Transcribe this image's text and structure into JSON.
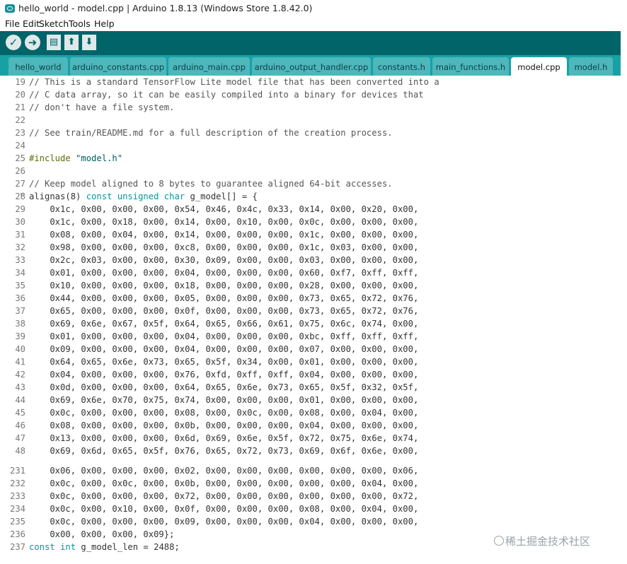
{
  "window": {
    "title": "hello_world - model.cpp | Arduino 1.8.13 (Windows Store 1.8.42.0)"
  },
  "menu": {
    "items": [
      "File",
      "Edit",
      "Sketch",
      "Tools",
      "Help"
    ]
  },
  "toolbar": {
    "buttons": [
      "verify-icon",
      "upload-icon",
      "new-icon",
      "open-icon",
      "save-icon"
    ]
  },
  "tabs": [
    {
      "label": "hello_world",
      "active": false
    },
    {
      "label": "arduino_constants.cpp",
      "active": false
    },
    {
      "label": "arduino_main.cpp",
      "active": false
    },
    {
      "label": "arduino_output_handler.cpp",
      "active": false
    },
    {
      "label": "constants.h",
      "active": false
    },
    {
      "label": "main_functions.h",
      "active": false
    },
    {
      "label": "model.cpp",
      "active": true
    },
    {
      "label": "model.h",
      "active": false
    }
  ],
  "editor": {
    "top_lines": [
      {
        "n": "19",
        "t": "// This is a standard TensorFlow Lite model file that has been converted into a"
      },
      {
        "n": "20",
        "t": "// C data array, so it can be easily compiled into a binary for devices that"
      },
      {
        "n": "21",
        "t": "// don't have a file system."
      },
      {
        "n": "22",
        "t": ""
      },
      {
        "n": "23",
        "t": "// See train/README.md for a full description of the creation process."
      },
      {
        "n": "24",
        "t": ""
      },
      {
        "n": "25",
        "t": "#include \"model.h\""
      },
      {
        "n": "26",
        "t": ""
      },
      {
        "n": "27",
        "t": "// Keep model aligned to 8 bytes to guarantee aligned 64-bit accesses."
      },
      {
        "n": "28",
        "t": "alignas(8) const unsigned char g_model[] = {"
      },
      {
        "n": "29",
        "t": "    0x1c, 0x00, 0x00, 0x00, 0x54, 0x46, 0x4c, 0x33, 0x14, 0x00, 0x20, 0x00,"
      },
      {
        "n": "30",
        "t": "    0x1c, 0x00, 0x18, 0x00, 0x14, 0x00, 0x10, 0x00, 0x0c, 0x00, 0x00, 0x00,"
      },
      {
        "n": "31",
        "t": "    0x08, 0x00, 0x04, 0x00, 0x14, 0x00, 0x00, 0x00, 0x1c, 0x00, 0x00, 0x00,"
      },
      {
        "n": "32",
        "t": "    0x98, 0x00, 0x00, 0x00, 0xc8, 0x00, 0x00, 0x00, 0x1c, 0x03, 0x00, 0x00,"
      },
      {
        "n": "33",
        "t": "    0x2c, 0x03, 0x00, 0x00, 0x30, 0x09, 0x00, 0x00, 0x03, 0x00, 0x00, 0x00,"
      },
      {
        "n": "34",
        "t": "    0x01, 0x00, 0x00, 0x00, 0x04, 0x00, 0x00, 0x00, 0x60, 0xf7, 0xff, 0xff,"
      },
      {
        "n": "35",
        "t": "    0x10, 0x00, 0x00, 0x00, 0x18, 0x00, 0x00, 0x00, 0x28, 0x00, 0x00, 0x00,"
      },
      {
        "n": "36",
        "t": "    0x44, 0x00, 0x00, 0x00, 0x05, 0x00, 0x00, 0x00, 0x73, 0x65, 0x72, 0x76,"
      },
      {
        "n": "37",
        "t": "    0x65, 0x00, 0x00, 0x00, 0x0f, 0x00, 0x00, 0x00, 0x73, 0x65, 0x72, 0x76,"
      },
      {
        "n": "38",
        "t": "    0x69, 0x6e, 0x67, 0x5f, 0x64, 0x65, 0x66, 0x61, 0x75, 0x6c, 0x74, 0x00,"
      },
      {
        "n": "39",
        "t": "    0x01, 0x00, 0x00, 0x00, 0x04, 0x00, 0x00, 0x00, 0xbc, 0xff, 0xff, 0xff,"
      },
      {
        "n": "40",
        "t": "    0x09, 0x00, 0x00, 0x00, 0x04, 0x00, 0x00, 0x00, 0x07, 0x00, 0x00, 0x00,"
      },
      {
        "n": "41",
        "t": "    0x64, 0x65, 0x6e, 0x73, 0x65, 0x5f, 0x34, 0x00, 0x01, 0x00, 0x00, 0x00,"
      },
      {
        "n": "42",
        "t": "    0x04, 0x00, 0x00, 0x00, 0x76, 0xfd, 0xff, 0xff, 0x04, 0x00, 0x00, 0x00,"
      },
      {
        "n": "43",
        "t": "    0x0d, 0x00, 0x00, 0x00, 0x64, 0x65, 0x6e, 0x73, 0x65, 0x5f, 0x32, 0x5f,"
      },
      {
        "n": "44",
        "t": "    0x69, 0x6e, 0x70, 0x75, 0x74, 0x00, 0x00, 0x00, 0x01, 0x00, 0x00, 0x00,"
      },
      {
        "n": "45",
        "t": "    0x0c, 0x00, 0x00, 0x00, 0x08, 0x00, 0x0c, 0x00, 0x08, 0x00, 0x04, 0x00,"
      },
      {
        "n": "46",
        "t": "    0x08, 0x00, 0x00, 0x00, 0x0b, 0x00, 0x00, 0x00, 0x04, 0x00, 0x00, 0x00,"
      },
      {
        "n": "47",
        "t": "    0x13, 0x00, 0x00, 0x00, 0x6d, 0x69, 0x6e, 0x5f, 0x72, 0x75, 0x6e, 0x74,"
      },
      {
        "n": "48",
        "t": "    0x69, 0x6d, 0x65, 0x5f, 0x76, 0x65, 0x72, 0x73, 0x69, 0x6f, 0x6e, 0x00,"
      }
    ],
    "bottom_lines": [
      {
        "n": "231",
        "t": "    0x06, 0x00, 0x00, 0x00, 0x02, 0x00, 0x00, 0x00, 0x00, 0x00, 0x00, 0x06,"
      },
      {
        "n": "232",
        "t": "    0x0c, 0x00, 0x0c, 0x00, 0x0b, 0x00, 0x00, 0x00, 0x00, 0x00, 0x04, 0x00,"
      },
      {
        "n": "233",
        "t": "    0x0c, 0x00, 0x00, 0x00, 0x72, 0x00, 0x00, 0x00, 0x00, 0x00, 0x00, 0x72,"
      },
      {
        "n": "234",
        "t": "    0x0c, 0x00, 0x10, 0x00, 0x0f, 0x00, 0x00, 0x00, 0x08, 0x00, 0x04, 0x00,"
      },
      {
        "n": "235",
        "t": "    0x0c, 0x00, 0x00, 0x00, 0x09, 0x00, 0x00, 0x00, 0x04, 0x00, 0x00, 0x00,"
      },
      {
        "n": "236",
        "t": "    0x00, 0x00, 0x00, 0x09};"
      },
      {
        "n": "237",
        "t": "const int g_model_len = 2488;"
      }
    ]
  },
  "watermark": "@稀土掘金技术社区"
}
